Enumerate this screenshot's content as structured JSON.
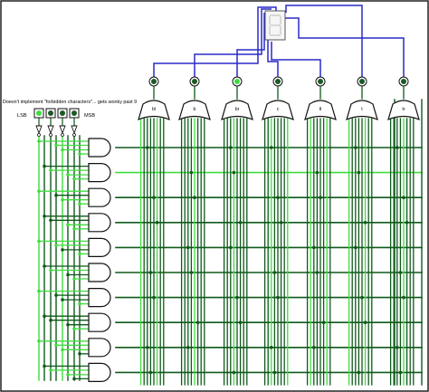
{
  "canvas": {
    "note": "Doesn't implement \"forbidden characters\"... gets wonky past 9",
    "lsb_label": "LSB",
    "msb_label": "MSB"
  },
  "segment_outputs": [
    "bl",
    "b",
    "br",
    "c",
    "tl",
    "t",
    "tr"
  ],
  "input_pin_count": 4,
  "and_gate_count": 10,
  "colors": {
    "background": "#ffffff",
    "grid_border": "#1a1a1a",
    "wire_off": "#0f5a1a",
    "wire_on": "#3fdc3f",
    "bus": "#2a2ac8",
    "pin_on": "#3fdc3f",
    "display_border": "#444444"
  }
}
